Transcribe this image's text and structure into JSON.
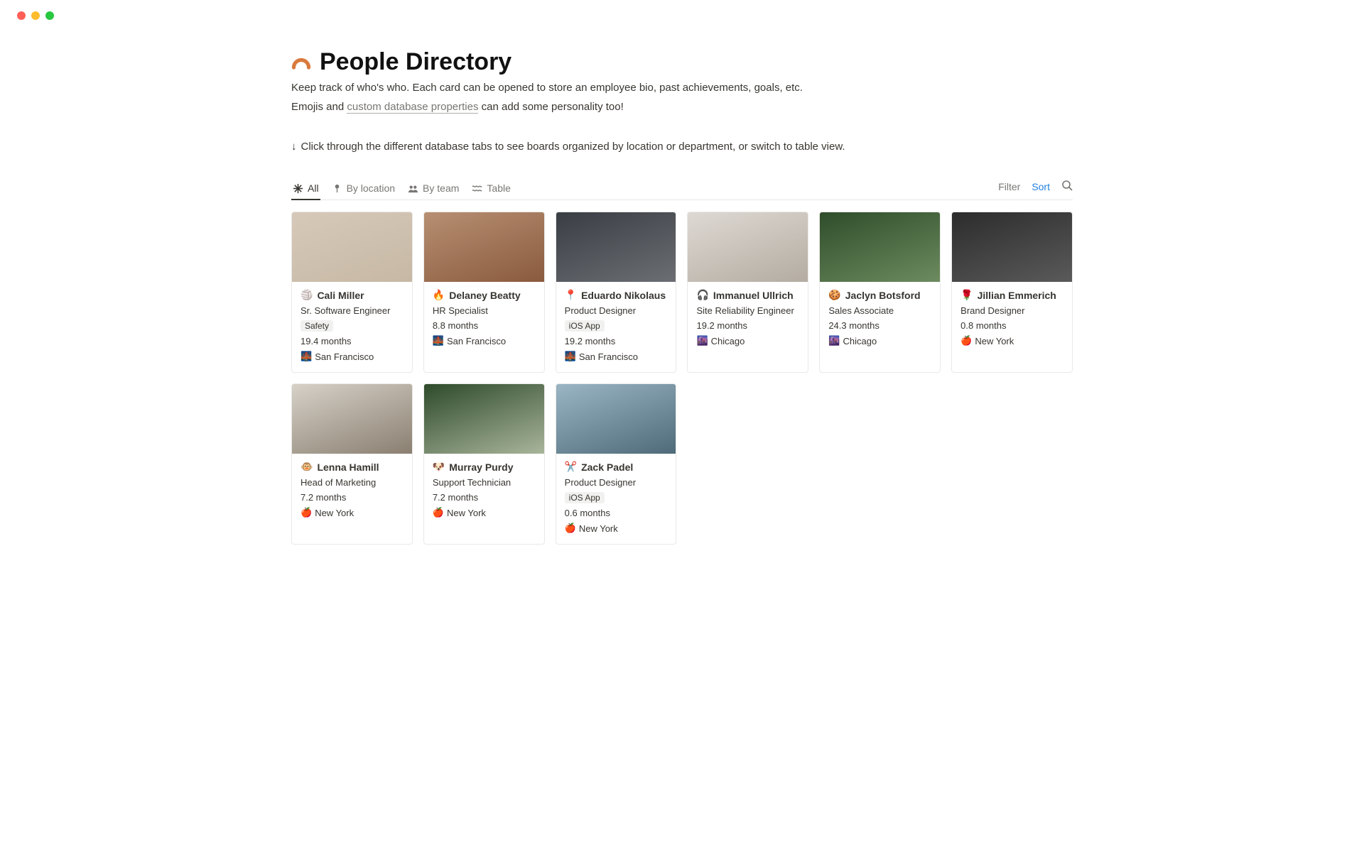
{
  "header": {
    "emoji_semantic": "arch-icon",
    "title": "People Directory",
    "desc_prefix": "Keep track of who's who. Each card can be opened to store an employee bio, past achievements, goals, etc.",
    "desc_line2_a": "Emojis and ",
    "desc_link": "custom database properties",
    "desc_line2_b": " can add some personality too!",
    "hint_arrow": "↓",
    "hint_text": "Click through the different database tabs to see boards organized by location or department, or switch to table view."
  },
  "tabs": [
    {
      "id": "all",
      "label": "All",
      "icon": "asterisk-icon",
      "active": true
    },
    {
      "id": "loc",
      "label": "By location",
      "icon": "pin-icon",
      "active": false
    },
    {
      "id": "team",
      "label": "By team",
      "icon": "people-icon",
      "active": false
    },
    {
      "id": "table",
      "label": "Table",
      "icon": "wave-icon",
      "active": false
    }
  ],
  "toolbar": {
    "filter": "Filter",
    "sort": "Sort"
  },
  "locations": {
    "sf": {
      "emoji": "🌉",
      "label": "San Francisco"
    },
    "chi": {
      "emoji": "🌆",
      "label": "Chicago"
    },
    "ny": {
      "emoji": "🍎",
      "label": "New York"
    }
  },
  "people": [
    {
      "emoji": "🏐",
      "name": "Cali Miller",
      "role": "Sr. Software Engineer",
      "tag": "Safety",
      "tenure": "19.4 months",
      "loc_emoji": "🌉",
      "loc": "San Francisco"
    },
    {
      "emoji": "🔥",
      "name": "Delaney Beatty",
      "role": "HR Specialist",
      "tag": "",
      "tenure": "8.8 months",
      "loc_emoji": "🌉",
      "loc": "San Francisco"
    },
    {
      "emoji": "📍",
      "name": "Eduardo Nikolaus",
      "role": "Product Designer",
      "tag": "iOS App",
      "tenure": "19.2 months",
      "loc_emoji": "🌉",
      "loc": "San Francisco"
    },
    {
      "emoji": "🎧",
      "name": "Immanuel Ullrich",
      "role": "Site Reliability Engineer",
      "tag": "",
      "tenure": "19.2 months",
      "loc_emoji": "🌆",
      "loc": "Chicago"
    },
    {
      "emoji": "🍪",
      "name": "Jaclyn Botsford",
      "role": "Sales Associate",
      "tag": "",
      "tenure": "24.3 months",
      "loc_emoji": "🌆",
      "loc": "Chicago"
    },
    {
      "emoji": "🌹",
      "name": "Jillian Emmerich",
      "role": "Brand Designer",
      "tag": "",
      "tenure": "0.8 months",
      "loc_emoji": "🍎",
      "loc": "New York"
    },
    {
      "emoji": "🐵",
      "name": "Lenna Hamill",
      "role": "Head of Marketing",
      "tag": "",
      "tenure": "7.2 months",
      "loc_emoji": "🍎",
      "loc": "New York"
    },
    {
      "emoji": "🐶",
      "name": "Murray Purdy",
      "role": "Support Technician",
      "tag": "",
      "tenure": "7.2 months",
      "loc_emoji": "🍎",
      "loc": "New York"
    },
    {
      "emoji": "✂️",
      "name": "Zack Padel",
      "role": "Product Designer",
      "tag": "iOS App",
      "tenure": "0.6 months",
      "loc_emoji": "🍎",
      "loc": "New York"
    }
  ]
}
